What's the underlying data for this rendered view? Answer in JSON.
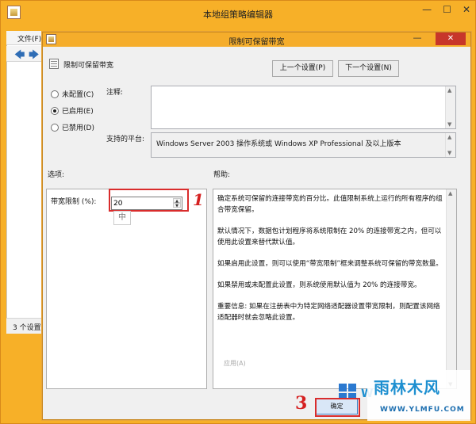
{
  "parent_window": {
    "title": "本地组策略编辑器",
    "menu_file": "文件(F)",
    "status": "3 个设置"
  },
  "dialog": {
    "title": "限制可保留带宽",
    "close_glyph": "✕",
    "minimize_glyph": "—",
    "policy_name": "限制可保留带宽",
    "prev_button": "上一个设置(P)",
    "next_button": "下一个设置(N)",
    "options": {
      "not_configured": "未配置(C)",
      "enabled": "已启用(E)",
      "disabled": "已禁用(D)",
      "selected": "enabled"
    },
    "comment_label": "注释:",
    "platform_label": "支持的平台:",
    "platform_text": "Windows Server 2003 操作系统或 Windows XP Professional 及以上版本",
    "options_header": "选项:",
    "help_header": "帮助:",
    "bandwidth_label": "带宽限制 (%):",
    "bandwidth_value": "20",
    "ime_indicator": "中",
    "help_paragraphs": [
      "确定系统可保留的连接带宽的百分比。此值限制系统上运行的所有程序的组合带宽保留。",
      "默认情况下，数据包计划程序将系统限制在 20% 的连接带宽之内，但可以使用此设置来替代默认值。",
      "如果启用此设置，则可以使用“带宽限制”框来调整系统可保留的带宽数量。",
      "如果禁用或未配置此设置，则系统使用默认值为 20% 的连接带宽。",
      "重要信息: 如果在注册表中为特定网络适配器设置带宽限制，则配置该网络适配器时就会忽略此设置。"
    ],
    "ghost_apply": "应用(A)",
    "ok_button": "确定"
  },
  "annotations": {
    "step_1": "1",
    "step_3": "3"
  },
  "watermark": {
    "main": "雨林木风",
    "sub": "WWW.YLMFU.COM",
    "logo_letter": "W"
  },
  "colors": {
    "desktop": "#f4a31f",
    "titlebar": "#f5ad2b",
    "close": "#c7362b",
    "annotation": "#d92c2c"
  }
}
